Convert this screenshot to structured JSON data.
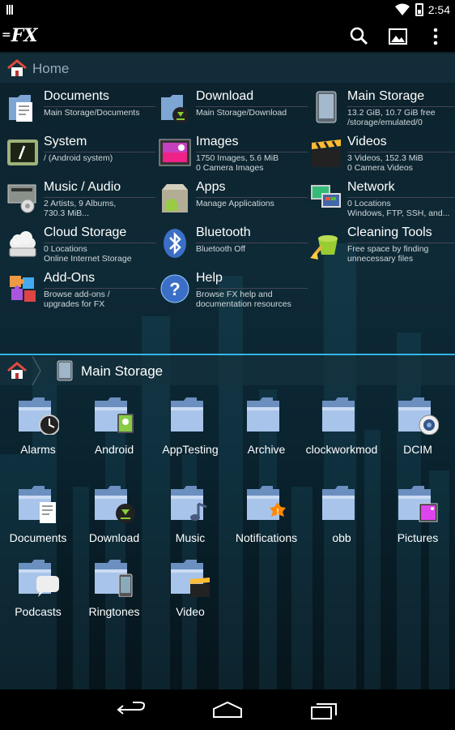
{
  "status": {
    "time": "2:54"
  },
  "app": {
    "logo": "FX"
  },
  "top_crumb": {
    "title": "Home"
  },
  "locations": [
    {
      "name": "Documents",
      "sub": "Main Storage/Documents",
      "icon": "documents-icon"
    },
    {
      "name": "Download",
      "sub": "Main Storage/Download",
      "icon": "download-icon"
    },
    {
      "name": "Main Storage",
      "sub": "13.2 GiB, 10.7 GiB free\n/storage/emulated/0",
      "icon": "tablet-icon"
    },
    {
      "name": "System",
      "sub": "/ (Android system)",
      "icon": "terminal-icon"
    },
    {
      "name": "Images",
      "sub": "1750 Images, 5.6 MiB\n0 Camera Images",
      "icon": "image-icon"
    },
    {
      "name": "Videos",
      "sub": "3 Videos, 152.3 MiB\n0 Camera Videos",
      "icon": "clapper-icon"
    },
    {
      "name": "Music / Audio",
      "sub": "2 Artists, 9 Albums,\n730.3 MiB...",
      "icon": "stereo-icon"
    },
    {
      "name": "Apps",
      "sub": "Manage Applications",
      "icon": "apps-icon"
    },
    {
      "name": "Network",
      "sub": "0 Locations\nWindows, FTP, SSH, and...",
      "icon": "network-icon"
    },
    {
      "name": "Cloud Storage",
      "sub": "0 Locations\nOnline Internet Storage",
      "icon": "cloud-icon"
    },
    {
      "name": "Bluetooth",
      "sub": "Bluetooth Off",
      "icon": "bluetooth-icon"
    },
    {
      "name": "Cleaning Tools",
      "sub": "Free space by finding\nunnecessary files",
      "icon": "bucket-icon"
    },
    {
      "name": "Add-Ons",
      "sub": "Browse add-ons /\nupgrades for FX",
      "icon": "puzzle-icon"
    },
    {
      "name": "Help",
      "sub": "Browse FX help and\ndocumentation resources",
      "icon": "help-icon"
    }
  ],
  "bottom_crumb": {
    "title": "Main Storage"
  },
  "folders": [
    {
      "label": "Alarms",
      "badge": "clock"
    },
    {
      "label": "Android",
      "badge": "android"
    },
    {
      "label": "AppTesting",
      "badge": ""
    },
    {
      "label": "Archive",
      "badge": ""
    },
    {
      "label": "clockworkmod",
      "badge": ""
    },
    {
      "label": "DCIM",
      "badge": "camera"
    },
    {
      "label": "Documents",
      "badge": "doc"
    },
    {
      "label": "Download",
      "badge": "download"
    },
    {
      "label": "Music",
      "badge": "note"
    },
    {
      "label": "Notifications",
      "badge": "alert"
    },
    {
      "label": "obb",
      "badge": ""
    },
    {
      "label": "Pictures",
      "badge": "picture"
    },
    {
      "label": "Podcasts",
      "badge": "bubble"
    },
    {
      "label": "Ringtones",
      "badge": "phone"
    },
    {
      "label": "Video",
      "badge": "clapper"
    }
  ]
}
